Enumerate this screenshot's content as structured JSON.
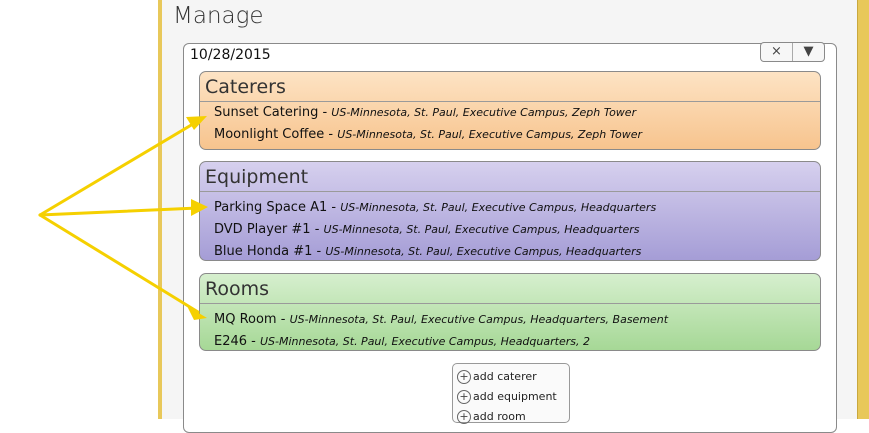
{
  "page_title": "Manage",
  "date": "10/28/2015",
  "controls": {
    "clear": "×",
    "dropdown": "▼"
  },
  "groups": [
    {
      "title": "Caterers",
      "items": [
        {
          "name": "Sunset Catering",
          "loc": "US-Minnesota, St. Paul, Executive Campus, Zeph Tower"
        },
        {
          "name": "Moonlight Coffee",
          "loc": "US-Minnesota, St. Paul, Executive Campus, Zeph Tower"
        }
      ]
    },
    {
      "title": "Equipment",
      "items": [
        {
          "name": "Parking Space A1",
          "loc": "US-Minnesota, St. Paul, Executive Campus, Headquarters"
        },
        {
          "name": "DVD Player #1",
          "loc": "US-Minnesota, St. Paul, Executive Campus, Headquarters"
        },
        {
          "name": "Blue Honda #1",
          "loc": "US-Minnesota, St. Paul, Executive Campus, Headquarters"
        }
      ]
    },
    {
      "title": "Rooms",
      "items": [
        {
          "name": "MQ Room",
          "loc": "US-Minnesota, St. Paul, Executive Campus, Headquarters, Basement"
        },
        {
          "name": "E246",
          "loc": "US-Minnesota, St. Paul, Executive Campus, Headquarters, 2"
        }
      ]
    }
  ],
  "add_buttons": {
    "caterer": "add caterer",
    "equipment": "add equipment",
    "room": "add room"
  },
  "separator": " - ",
  "colors": {
    "frame": "#e8c85a",
    "arrow": "#f5d000"
  }
}
